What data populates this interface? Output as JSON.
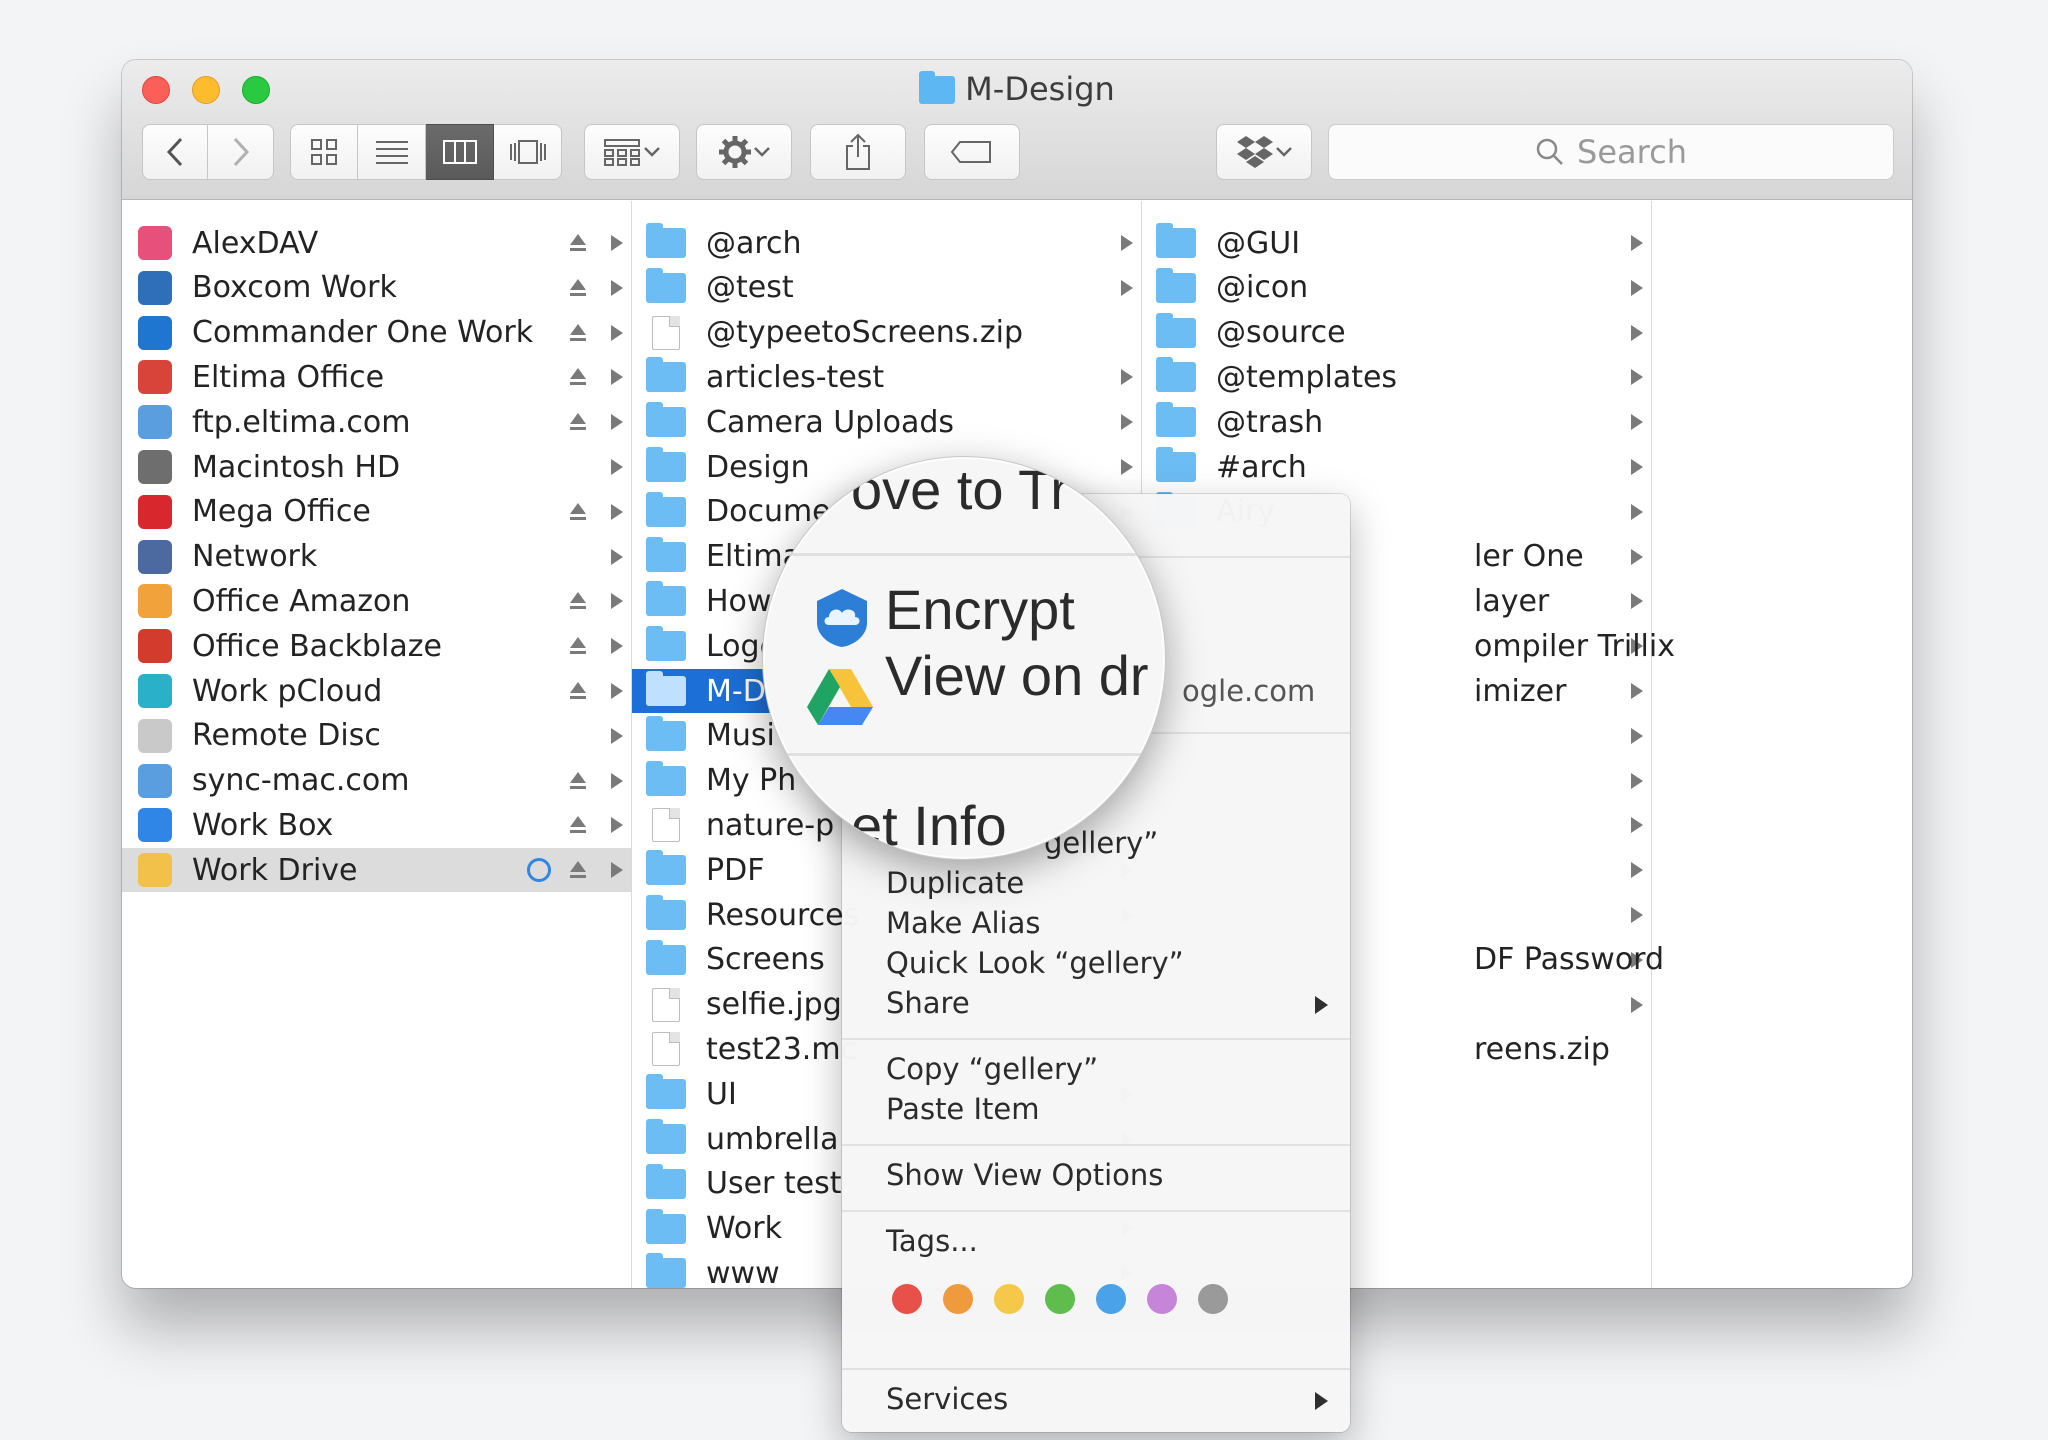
{
  "window": {
    "title": "M-Design"
  },
  "toolbar": {
    "search_placeholder": "Search"
  },
  "sidebar": {
    "items": [
      {
        "label": "AlexDAV",
        "icon": "webdav-icon",
        "color": "#e7507a",
        "eject": true
      },
      {
        "label": "Boxcom Work",
        "icon": "box-icon",
        "color": "#2f6fba",
        "eject": true
      },
      {
        "label": "Commander One Work",
        "icon": "cloud-icon",
        "color": "#1f76d0",
        "eject": true
      },
      {
        "label": "Eltima Office",
        "icon": "eltima-icon",
        "color": "#d9443a",
        "eject": true
      },
      {
        "label": "ftp.eltima.com",
        "icon": "ftp-globe-icon",
        "color": "#5a9ee0",
        "eject": true
      },
      {
        "label": "Macintosh HD",
        "icon": "harddrive-icon",
        "color": "#6e6e6e",
        "eject": false
      },
      {
        "label": "Mega Office",
        "icon": "mega-icon",
        "color": "#d9272e",
        "eject": true
      },
      {
        "label": "Network",
        "icon": "network-globe-icon",
        "color": "#4c6aa0",
        "eject": false
      },
      {
        "label": "Office Amazon",
        "icon": "amazon-icon",
        "color": "#f2a23a",
        "eject": true
      },
      {
        "label": "Office Backblaze",
        "icon": "backblaze-icon",
        "color": "#d33b2c",
        "eject": true
      },
      {
        "label": "Work pCloud",
        "icon": "pcloud-icon",
        "color": "#2bb0c9",
        "eject": true
      },
      {
        "label": "Remote Disc",
        "icon": "disc-icon",
        "color": "#c9c9c9",
        "eject": false
      },
      {
        "label": "sync-mac.com",
        "icon": "ftp-globe-icon",
        "color": "#5a9ee0",
        "eject": true
      },
      {
        "label": "Work Box",
        "icon": "dropbox-icon",
        "color": "#2f86e6",
        "eject": true
      },
      {
        "label": "Work Drive",
        "icon": "google-drive-icon",
        "color": "#f2c14a",
        "eject": true,
        "selected": true,
        "sync": true
      }
    ]
  },
  "column2": {
    "items": [
      {
        "label": "@arch",
        "type": "folder",
        "arrow": true
      },
      {
        "label": "@test",
        "type": "folder",
        "arrow": true
      },
      {
        "label": "@typeetoScreens.zip",
        "type": "file",
        "arrow": false
      },
      {
        "label": "articles-test",
        "type": "folder",
        "arrow": true
      },
      {
        "label": "Camera Uploads",
        "type": "folder",
        "arrow": true
      },
      {
        "label": "Design",
        "type": "folder",
        "arrow": true
      },
      {
        "label": "Documen",
        "type": "folder",
        "arrow": true
      },
      {
        "label": "Eltima",
        "type": "folder",
        "arrow": true
      },
      {
        "label": "Howt",
        "type": "folder",
        "arrow": true
      },
      {
        "label": "Logc",
        "type": "folder",
        "arrow": true
      },
      {
        "label": "M-D",
        "type": "folder",
        "arrow": true,
        "selected": true
      },
      {
        "label": "Musi",
        "type": "folder",
        "arrow": true
      },
      {
        "label": "My Ph",
        "type": "folder",
        "arrow": true
      },
      {
        "label": "nature-p",
        "type": "file",
        "arrow": false
      },
      {
        "label": "PDF",
        "type": "folder",
        "arrow": true
      },
      {
        "label": "Resources",
        "type": "folder",
        "arrow": true
      },
      {
        "label": "Screens",
        "type": "folder",
        "arrow": true
      },
      {
        "label": "selfie.jpg",
        "type": "file",
        "arrow": false
      },
      {
        "label": "test23.mc",
        "type": "file",
        "arrow": false
      },
      {
        "label": "UI",
        "type": "folder",
        "arrow": true
      },
      {
        "label": "umbrella",
        "type": "folder",
        "arrow": true
      },
      {
        "label": "User test",
        "type": "folder",
        "arrow": true
      },
      {
        "label": "Work",
        "type": "folder",
        "arrow": true
      },
      {
        "label": "www",
        "type": "folder",
        "arrow": true
      }
    ]
  },
  "column3": {
    "items": [
      {
        "label": "@GUI",
        "type": "folder",
        "row": 0
      },
      {
        "label": "@icon",
        "type": "folder",
        "row": 1
      },
      {
        "label": "@source",
        "type": "folder",
        "row": 2
      },
      {
        "label": "@templates",
        "type": "folder",
        "row": 3
      },
      {
        "label": "@trash",
        "type": "folder",
        "row": 4
      },
      {
        "label": "#arch",
        "type": "folder",
        "row": 5
      },
      {
        "label": "Airy",
        "type": "folder",
        "row": 6
      }
    ],
    "fragments": [
      {
        "label": "ler One",
        "row": 7
      },
      {
        "label": "layer",
        "row": 8
      },
      {
        "label": "ompiler Trillix",
        "row": 9
      },
      {
        "label": "imizer",
        "row": 10
      },
      {
        "label": "DF Password",
        "row": 16
      },
      {
        "label": "reens.zip",
        "row": 18
      }
    ],
    "arrow_rows": [
      0,
      1,
      2,
      3,
      4,
      5,
      6,
      7,
      8,
      9,
      10,
      11,
      12,
      13,
      14,
      15,
      16,
      17
    ]
  },
  "context_menu": {
    "drive_suffix": "ogle.com",
    "get_info_suffix": "gellery”",
    "duplicate": "Duplicate",
    "make_alias": "Make Alias",
    "quick_look": "Quick Look “gellery”",
    "share": "Share",
    "copy": "Copy “gellery”",
    "paste": "Paste Item",
    "view_options": "Show View Options",
    "tags": "Tags...",
    "services": "Services",
    "tag_colors": [
      "#e8514a",
      "#f09a3e",
      "#f5c84a",
      "#5fbd4e",
      "#4aa2e8",
      "#c685d8",
      "#9a9a9a"
    ]
  },
  "magnifier": {
    "move_to_trash_partial": "ove to Tr",
    "encrypt": "Encrypt",
    "view_on_drive_partial": "View on dr",
    "get_info_partial": "et Info"
  }
}
